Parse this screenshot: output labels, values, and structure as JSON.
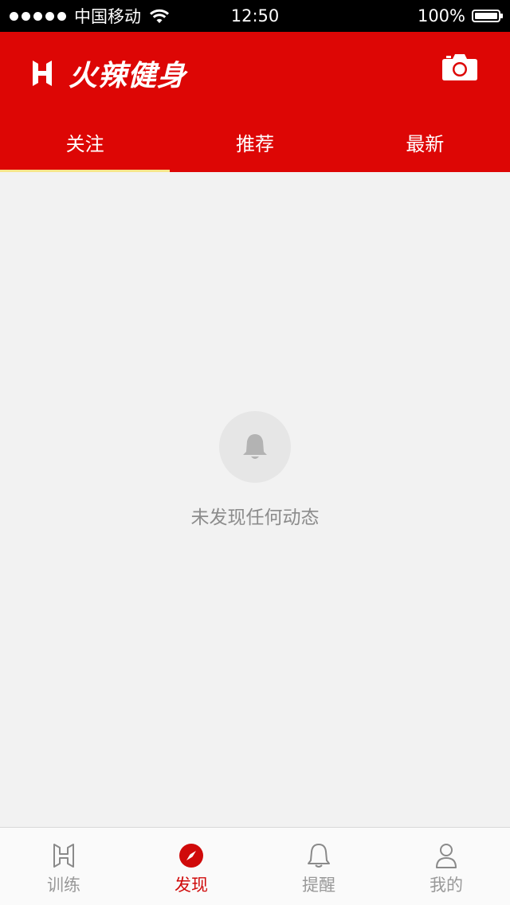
{
  "status_bar": {
    "carrier": "中国移动",
    "time": "12:50",
    "battery_percent": "100%"
  },
  "header": {
    "app_name": "火辣健身",
    "camera_icon": "camera-icon",
    "brand_color": "#dd0605"
  },
  "tabs": [
    {
      "label": "关注",
      "active": true
    },
    {
      "label": "推荐",
      "active": false
    },
    {
      "label": "最新",
      "active": false
    }
  ],
  "empty_state": {
    "icon": "bell-icon",
    "message": "未发现任何动态"
  },
  "tabbar": {
    "items": [
      {
        "label": "训练",
        "icon": "training-logo-icon",
        "active": false
      },
      {
        "label": "发现",
        "icon": "compass-icon",
        "active": true
      },
      {
        "label": "提醒",
        "icon": "bell-icon",
        "active": false
      },
      {
        "label": "我的",
        "icon": "user-icon",
        "active": false
      }
    ]
  }
}
